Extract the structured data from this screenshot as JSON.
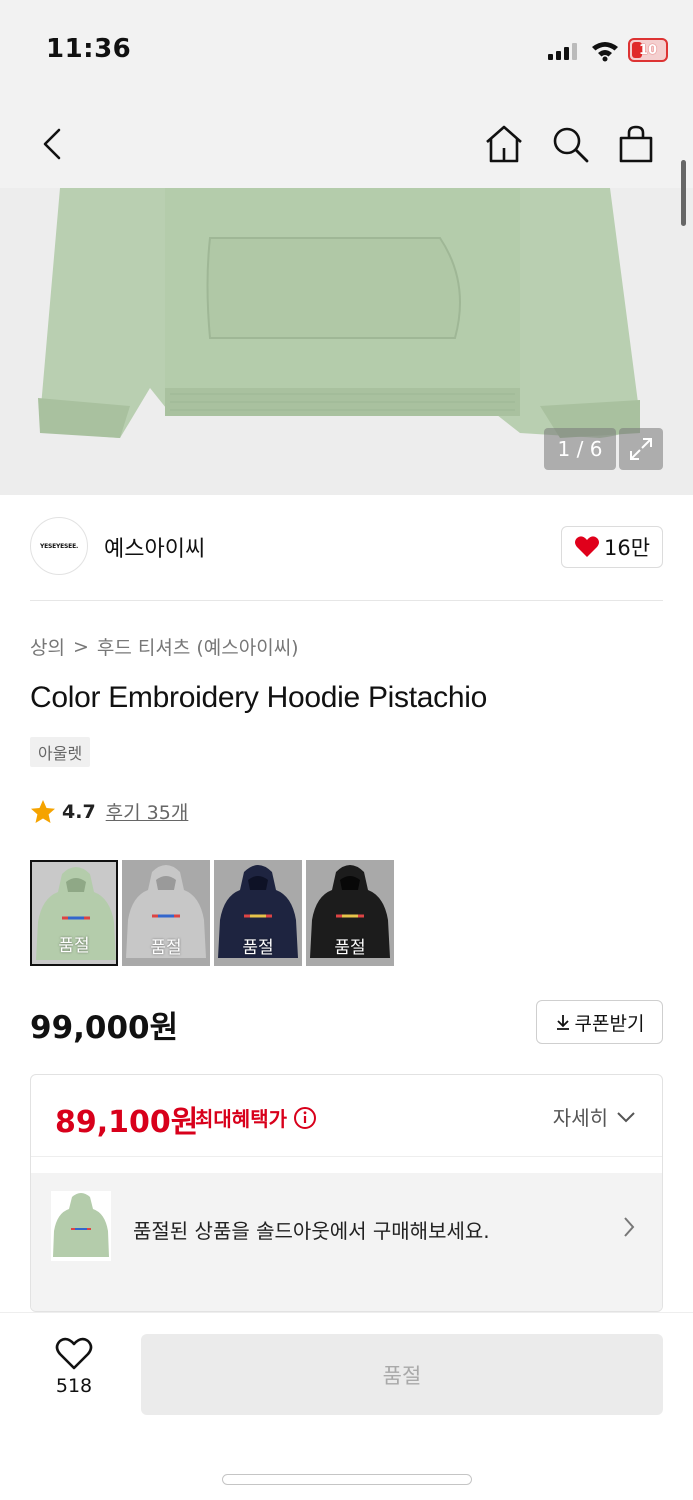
{
  "status_bar": {
    "time": "11:36",
    "battery": "10"
  },
  "hero": {
    "counter": "1 / 6"
  },
  "brand": {
    "logo_text": "YESEYESEE.",
    "name": "예스아이씨",
    "likes": "16만"
  },
  "breadcrumb": {
    "category": "상의",
    "separator": ">",
    "subcategory": "후드 티셔츠 (예스아이씨)"
  },
  "product": {
    "title": "Color Embroidery Hoodie Pistachio",
    "tag": "아울렛"
  },
  "rating": {
    "score": "4.7",
    "reviews": "후기 35개"
  },
  "swatches": [
    {
      "color": "#b4ccab",
      "label": "품절"
    },
    {
      "color": "#c7c7c7",
      "label": "품절"
    },
    {
      "color": "#1e2440",
      "label": "품절"
    },
    {
      "color": "#1c1c1c",
      "label": "품절"
    }
  ],
  "price": {
    "original": "99,000원",
    "coupon_label": "쿠폰받기"
  },
  "benefit": {
    "price": "89,100원",
    "label": "최대혜택가",
    "detail": "자세히",
    "soldout_message": "품절된 상품을 솔드아웃에서 구매해보세요."
  },
  "bottom": {
    "wish_count": "518",
    "buy_label": "품절"
  },
  "colors": {
    "accent_red": "#d8001b",
    "heart_red": "#e0001b",
    "product_green": "#b4ccab"
  }
}
